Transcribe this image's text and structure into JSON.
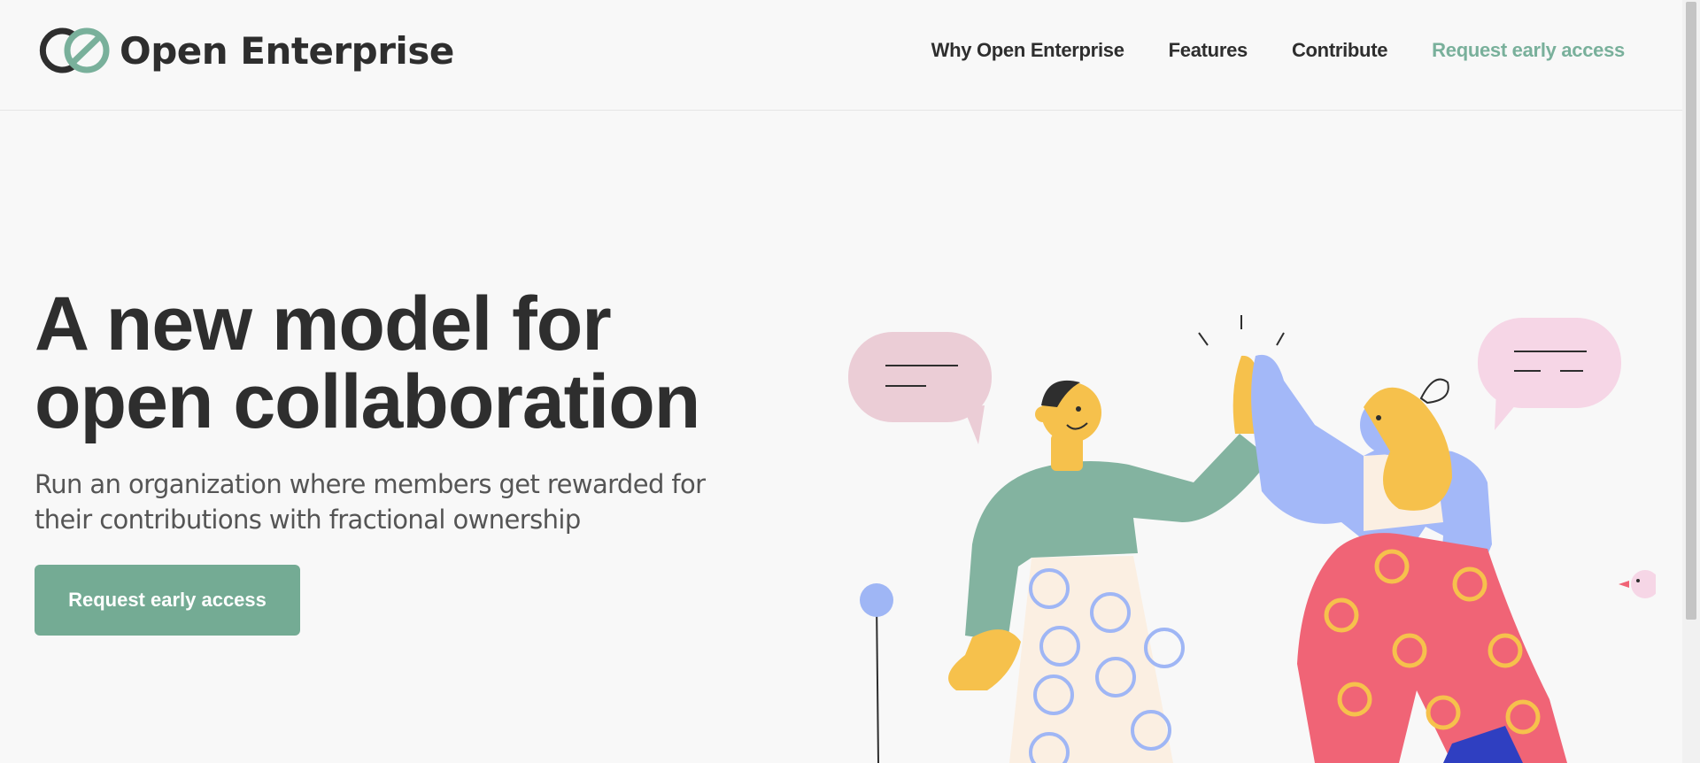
{
  "header": {
    "brand_name": "Open Enterprise",
    "nav": [
      {
        "label": "Why Open Enterprise"
      },
      {
        "label": "Features"
      },
      {
        "label": "Contribute"
      },
      {
        "label": "Request early access"
      }
    ]
  },
  "hero": {
    "title_line1": "A new model for",
    "title_line2": "open collaboration",
    "subtitle": "Run an organization where members get rewarded for their contributions with fractional ownership",
    "cta_label": "Request early access"
  },
  "colors": {
    "accent": "#79b09b",
    "cta_background": "#74ab94",
    "text": "#2e2e2e",
    "background": "#f8f8f8"
  },
  "icons": {
    "logo": "oe-logo-icon",
    "illustration": "high-five-illustration"
  }
}
